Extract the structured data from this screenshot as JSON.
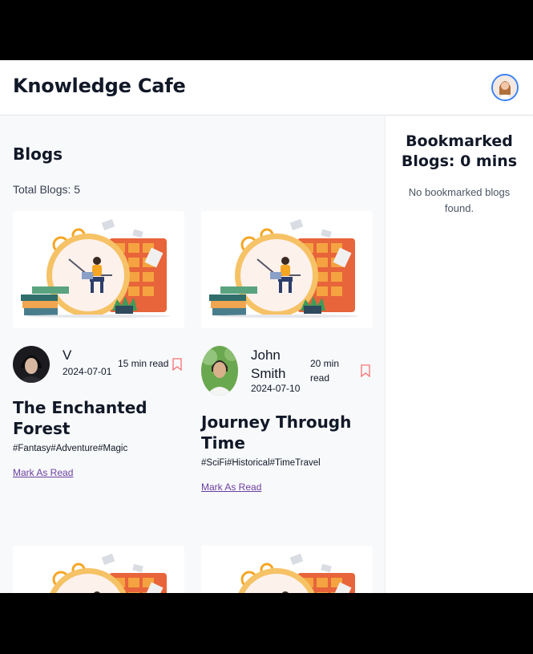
{
  "header": {
    "brand": "Knowledge Cafe",
    "avatar_icon": "user-avatar"
  },
  "main": {
    "title": "Blogs",
    "total_label": "Total Blogs: 5",
    "cards": [
      {
        "author": "V",
        "date": "2024-07-01",
        "read_time": "15 min read",
        "title": "The Enchanted Forest",
        "tags": "#Fantasy#Adventure#Magic",
        "mark_label": "Mark As Read"
      },
      {
        "author": "John Smith",
        "date": "2024-07-10",
        "read_time": "20 min read",
        "title": "Journey Through Time",
        "tags": "#SciFi#Historical#TimeTravel",
        "mark_label": "Mark As Read"
      },
      {},
      {}
    ]
  },
  "sidebar": {
    "title": "Bookmarked Blogs: 0 mins",
    "empty_text": "No bookmarked blogs found."
  },
  "colors": {
    "bookmark": "#f87171",
    "link": "#6b3fa0",
    "avatar_border": "#3b82f6"
  }
}
